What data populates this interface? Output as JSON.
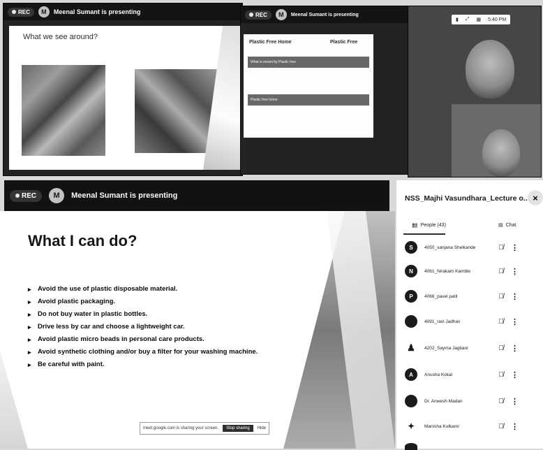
{
  "top_strip": {
    "panel1": {
      "rec": "REC",
      "avatar_letter": "M",
      "presenter": "Meenal Sumant is presenting",
      "slide_title": "What we see around?"
    },
    "panel2": {
      "rec": "REC",
      "avatar_letter": "M",
      "presenter": "Meenal Sumant is presenting",
      "tab1": "Plastic Free Home",
      "tab2": "Plastic Free",
      "band1": "What is meant by Plastic free",
      "band2": "Plastic free home"
    },
    "panel3": {
      "time": "5:40 PM"
    }
  },
  "main": {
    "rec": "REC",
    "avatar_letter": "M",
    "presenter": "Meenal Sumant is presenting",
    "slide": {
      "heading": "What I can do?",
      "bullets": [
        "Avoid the use of plastic disposable material.",
        "Avoid plastic packaging.",
        "Do not buy water in plastic bottles.",
        "Drive less by car and choose a lightweight car.",
        "Avoid plastic micro beads in personal care products.",
        "Avoid synthetic clothing and/or buy a filter for your washing machine.",
        "Be careful with paint."
      ]
    },
    "share_bar": {
      "text": "meet.google.com is sharing your screen.",
      "stop": "Stop sharing",
      "hide": "Hide"
    }
  },
  "side_panel": {
    "title": "NSS_Majhi Vasundhara_Lecture o...",
    "close": "×",
    "tab_people": "People (43)",
    "tab_chat": "Chat",
    "participants": [
      {
        "letter": "S",
        "name": "4050_sanjana Shelkande"
      },
      {
        "letter": "N",
        "name": "4061_Nirakam Kamble"
      },
      {
        "letter": "P",
        "name": "4066_pavel patil"
      },
      {
        "letter": "",
        "name": "4091_ravi Jadhav"
      },
      {
        "letter": "",
        "name": "4202_Sayma Jagtiani"
      },
      {
        "letter": "A",
        "name": "Anusha Kokal"
      },
      {
        "letter": "",
        "name": "Dr. Anwesh Madan"
      },
      {
        "letter": "",
        "name": "Manisha Kulkarni"
      }
    ]
  },
  "icons": {
    "mic_off": "mic-off-icon",
    "more": "more-vert-icon",
    "people": "people-icon",
    "chat": "chat-icon",
    "close": "close-icon"
  }
}
